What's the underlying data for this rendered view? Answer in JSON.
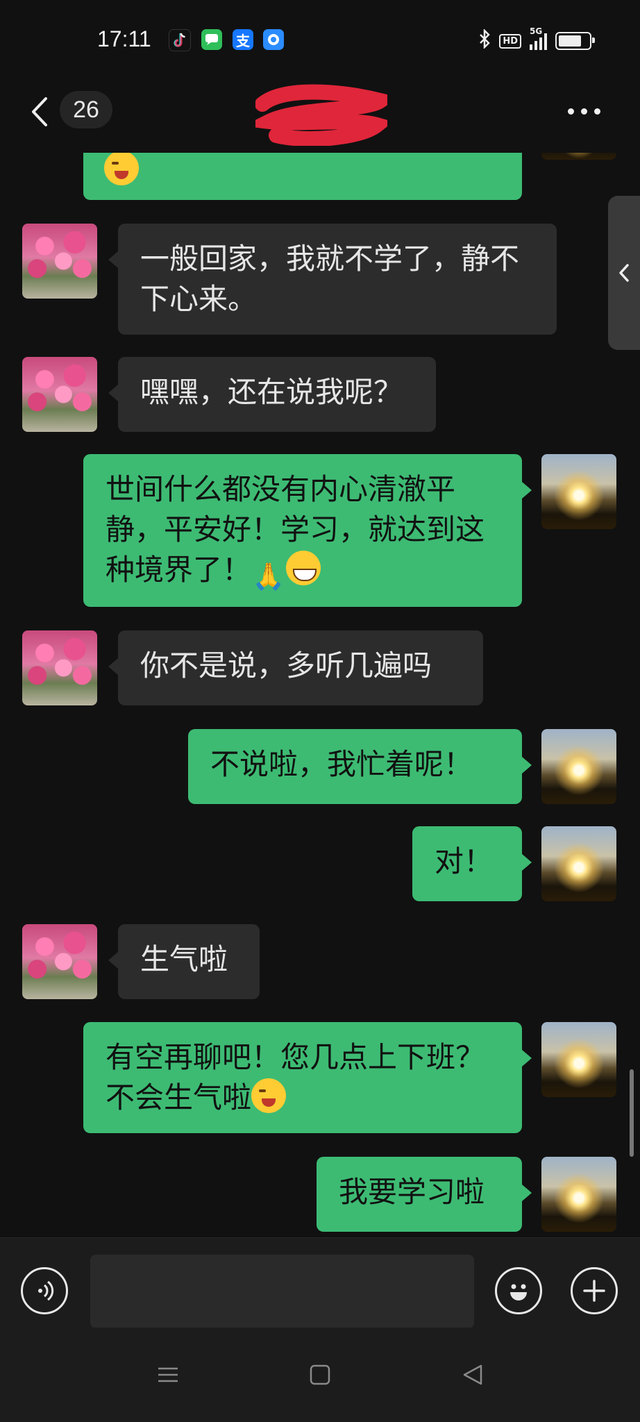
{
  "status_bar": {
    "time": "17:11",
    "app_icons": [
      "tiktok-icon",
      "messages-icon",
      "alipay-icon",
      "browser-icon"
    ],
    "alipay_glyph": "支",
    "network_label": "5G",
    "hd_label": "HD",
    "battery_level": 0.85
  },
  "nav": {
    "unread_count": "26",
    "title": "",
    "title_redacted": true
  },
  "messages": [
    {
      "sender": "me",
      "text": "",
      "emoji": "wink",
      "partial": true
    },
    {
      "sender": "contact",
      "text": "一般回家，我就不学了，静不下心来。"
    },
    {
      "sender": "contact",
      "text": "嘿嘿，还在说我呢？"
    },
    {
      "sender": "me",
      "text": "世间什么都没有内心清澈平静，平安好！学习，就达到这种境界了！"
    },
    {
      "sender": "contact",
      "text": "你不是说，多听几遍吗"
    },
    {
      "sender": "me",
      "text": "不说啦，我忙着呢！"
    },
    {
      "sender": "me",
      "text": "对！"
    },
    {
      "sender": "contact",
      "text": "生气啦"
    },
    {
      "sender": "me",
      "text": "有空再聊吧！您几点上下班？不会生气啦"
    },
    {
      "sender": "me",
      "text": "我要学习啦"
    }
  ],
  "input": {
    "placeholder": "",
    "value": ""
  },
  "colors": {
    "background": "#111111",
    "incoming_bubble": "#2c2c2c",
    "outgoing_bubble": "#3dbb73"
  }
}
